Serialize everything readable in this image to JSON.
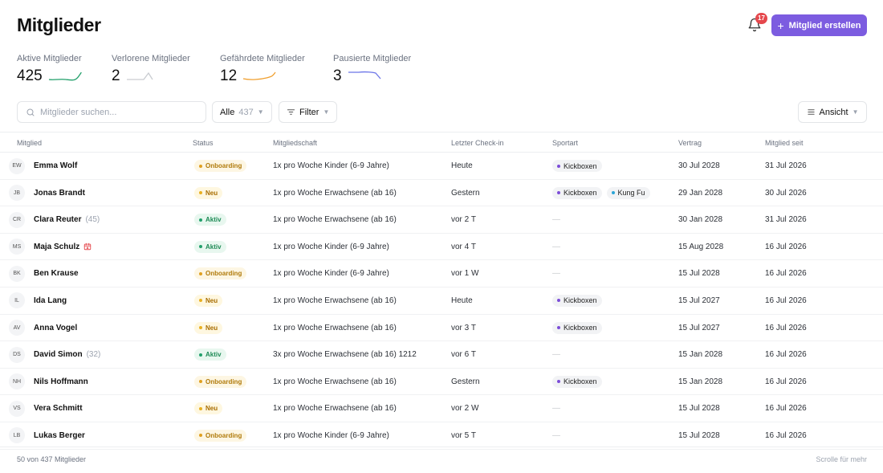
{
  "header": {
    "title": "Mitglieder",
    "notification_count": "17",
    "create_button_label": "Mitglied erstellen"
  },
  "stats": [
    {
      "label": "Aktive Mitglieder",
      "value": "425",
      "color": "#22a06b"
    },
    {
      "label": "Verlorene Mitglieder",
      "value": "2",
      "color": "#c9ccd1"
    },
    {
      "label": "Gefährdete Mitglieder",
      "value": "12",
      "color": "#f0a030"
    },
    {
      "label": "Pausierte Mitglieder",
      "value": "3",
      "color": "#6b74e8"
    }
  ],
  "toolbar": {
    "search_placeholder": "Mitglieder suchen...",
    "all_label": "Alle",
    "all_count": "437",
    "filter_label": "Filter",
    "view_label": "Ansicht"
  },
  "table": {
    "columns": [
      "Mitglied",
      "Status",
      "Mitgliedschaft",
      "Letzter Check-in",
      "Sportart",
      "Vertrag",
      "Mitglied seit"
    ],
    "rows": [
      {
        "initials": "EW",
        "name": "Emma Wolf",
        "age": "",
        "alert": false,
        "status": "Onboarding",
        "membership": "1x pro Woche Kinder (6-9 Jahre)",
        "checkin": "Heute",
        "sports": [
          "Kickboxen"
        ],
        "contract": "30 Jul 2028",
        "since": "31 Jul 2026"
      },
      {
        "initials": "JB",
        "name": "Jonas Brandt",
        "age": "",
        "alert": false,
        "status": "Neu",
        "membership": "1x pro Woche Erwachsene (ab 16)",
        "checkin": "Gestern",
        "sports": [
          "Kickboxen",
          "Kung Fu"
        ],
        "contract": "29 Jan 2028",
        "since": "30 Jul 2026"
      },
      {
        "initials": "CR",
        "name": "Clara Reuter",
        "age": "(45)",
        "alert": false,
        "status": "Aktiv",
        "membership": "1x pro Woche Erwachsene (ab 16)",
        "checkin": "vor 2 T",
        "sports": [],
        "contract": "30 Jan 2028",
        "since": "31 Jul 2026"
      },
      {
        "initials": "MS",
        "name": "Maja Schulz",
        "age": "",
        "alert": true,
        "status": "Aktiv",
        "membership": "1x pro Woche Kinder (6-9 Jahre)",
        "checkin": "vor 4 T",
        "sports": [],
        "contract": "15 Aug 2028",
        "since": "16 Jul 2026"
      },
      {
        "initials": "BK",
        "name": "Ben Krause",
        "age": "",
        "alert": false,
        "status": "Onboarding",
        "membership": "1x pro Woche Kinder (6-9 Jahre)",
        "checkin": "vor 1 W",
        "sports": [],
        "contract": "15 Jul 2028",
        "since": "16 Jul 2026"
      },
      {
        "initials": "IL",
        "name": "Ida Lang",
        "age": "",
        "alert": false,
        "status": "Neu",
        "membership": "1x pro Woche Erwachsene (ab 16)",
        "checkin": "Heute",
        "sports": [
          "Kickboxen"
        ],
        "contract": "15 Jul 2027",
        "since": "16 Jul 2026"
      },
      {
        "initials": "AV",
        "name": "Anna Vogel",
        "age": "",
        "alert": false,
        "status": "Neu",
        "membership": "1x pro Woche Erwachsene (ab 16)",
        "checkin": "vor 3 T",
        "sports": [
          "Kickboxen"
        ],
        "contract": "15 Jul 2027",
        "since": "16 Jul 2026"
      },
      {
        "initials": "DS",
        "name": "David Simon",
        "age": "(32)",
        "alert": false,
        "status": "Aktiv",
        "membership": "3x pro Woche Erwachsene (ab 16) 1212",
        "checkin": "vor 6 T",
        "sports": [],
        "contract": "15 Jan 2028",
        "since": "16 Jul 2026"
      },
      {
        "initials": "NH",
        "name": "Nils Hoffmann",
        "age": "",
        "alert": false,
        "status": "Onboarding",
        "membership": "1x pro Woche Erwachsene (ab 16)",
        "checkin": "Gestern",
        "sports": [
          "Kickboxen"
        ],
        "contract": "15 Jan 2028",
        "since": "16 Jul 2026"
      },
      {
        "initials": "VS",
        "name": "Vera Schmitt",
        "age": "",
        "alert": false,
        "status": "Neu",
        "membership": "1x pro Woche Erwachsene (ab 16)",
        "checkin": "vor 2 W",
        "sports": [],
        "contract": "15 Jul 2028",
        "since": "16 Jul 2026"
      },
      {
        "initials": "LB",
        "name": "Lukas Berger",
        "age": "",
        "alert": false,
        "status": "Onboarding",
        "membership": "1x pro Woche Kinder (6-9 Jahre)",
        "checkin": "vor 5 T",
        "sports": [],
        "contract": "15 Jul 2028",
        "since": "16 Jul 2026"
      }
    ],
    "empty_placeholder": "—"
  },
  "status_styles": {
    "Onboarding": {
      "bg": "#fdf6e3",
      "fg": "#b07a0a",
      "dot": "#e0a020"
    },
    "Neu": {
      "bg": "#fef7e0",
      "fg": "#a86d00",
      "dot": "#e8b020"
    },
    "Aktiv": {
      "bg": "#e8f7ef",
      "fg": "#1d8a55",
      "dot": "#22a06b"
    }
  },
  "sport_colors": {
    "Kickboxen": "#7c4dd8",
    "Kung Fu": "#2aa5d8"
  },
  "footer": {
    "count_text": "50 von 437 Mitglieder",
    "scroll_hint": "Scrolle für mehr"
  },
  "icons": {
    "bell": "bell-icon",
    "search": "search-icon",
    "filter": "filter-icon",
    "view": "list-icon",
    "alert": "calendar-alert-icon"
  }
}
